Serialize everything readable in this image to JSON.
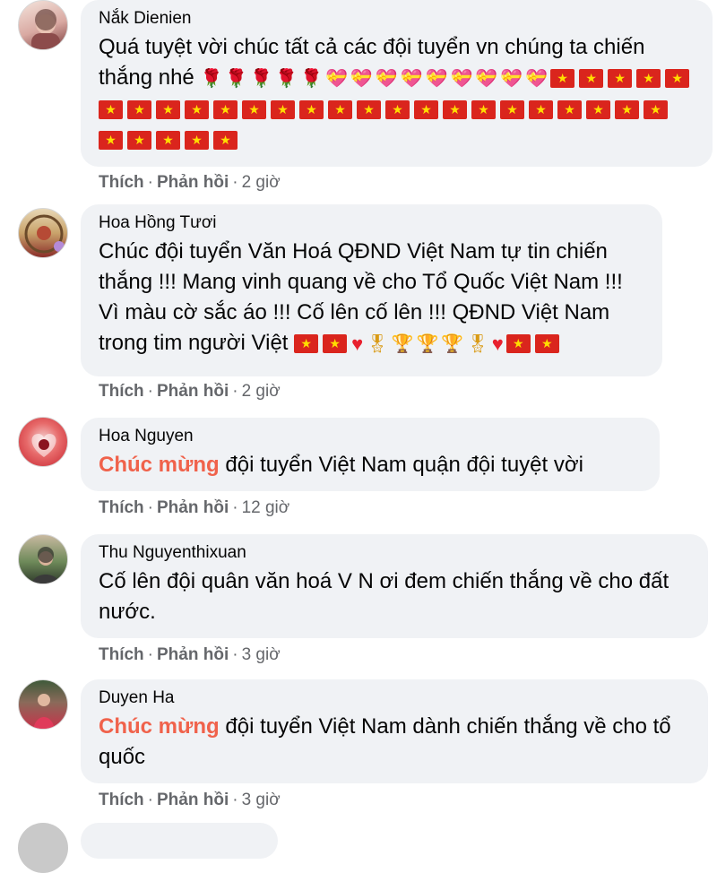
{
  "comments": [
    {
      "author": "Nắk Dienien",
      "text": "Quá tuyệt vời chúc tất cả các đội tuyển vn chúng ta chiến thắng nhé",
      "emoji": [
        "rose",
        "rose",
        "rose",
        "rose",
        "rose",
        "gift",
        "gift",
        "gift",
        "gift",
        "gift",
        "gift",
        "gift",
        "gift",
        "gift",
        "flag",
        "flag",
        "flag",
        "flag",
        "flag",
        "flag",
        "flag",
        "flag",
        "flag",
        "flag",
        "flag",
        "flag",
        "flag",
        "flag",
        "flag",
        "flag",
        "flag",
        "flag",
        "flag",
        "flag",
        "flag",
        "flag",
        "flag",
        "flag",
        "flag",
        "flag",
        "flag",
        "flag",
        "flag",
        "flag"
      ],
      "like": "Thích",
      "reply": "Phản hồi",
      "time": "2 giờ",
      "avatar_colors": [
        "#d9a9a2",
        "#7b3b3b",
        "#f4e4dc"
      ]
    },
    {
      "author": "Hoa Hồng Tươi",
      "text": "Chúc đội tuyển Văn Hoá QĐND Việt Nam tự tin chiến thắng !!! Mang vinh quang về cho Tổ Quốc Việt Nam !!! Vì màu cờ sắc áo !!! Cố lên cố lên !!! QĐND Việt Nam trong tim người Việt",
      "emoji": [
        "flag",
        "flag",
        "heart",
        "medal",
        "trophy",
        "trophy",
        "trophy",
        "medal",
        "heart",
        "flag",
        "flag"
      ],
      "like": "Thích",
      "reply": "Phản hồi",
      "time": "2 giờ",
      "avatar_colors": [
        "#c9a36b",
        "#8a2d28",
        "#e8d7b5"
      ]
    },
    {
      "author": "Hoa Nguyen",
      "highlight": "Chúc mừng",
      "text": "đội tuyển Việt Nam quận đội tuyệt vời",
      "like": "Thích",
      "reply": "Phản hồi",
      "time": "12 giờ",
      "avatar_colors": [
        "#c7242f",
        "#e76a6a",
        "#f4d0d0"
      ]
    },
    {
      "author": "Thu Nguyenthixuan",
      "text": "Cố lên đội quân văn hoá V N ơi đem chiến thắng về cho đất nước.",
      "like": "Thích",
      "reply": "Phản hồi",
      "time": "3 giờ",
      "avatar_colors": [
        "#6e8a5a",
        "#2f3a2a",
        "#c8b9a0"
      ]
    },
    {
      "author": "Duyen Ha",
      "highlight": "Chúc mừng",
      "text": "đội tuyển Việt Nam dành chiến thắng về cho tổ quốc",
      "like": "Thích",
      "reply": "Phản hồi",
      "time": "3 giờ",
      "avatar_colors": [
        "#c7324a",
        "#3f5a3a",
        "#e8a0b0"
      ]
    }
  ],
  "emoji_glyphs": {
    "rose": "🌹",
    "gift": "💝",
    "heart": "♥",
    "trophy": "🏆",
    "medal": "🎖"
  }
}
